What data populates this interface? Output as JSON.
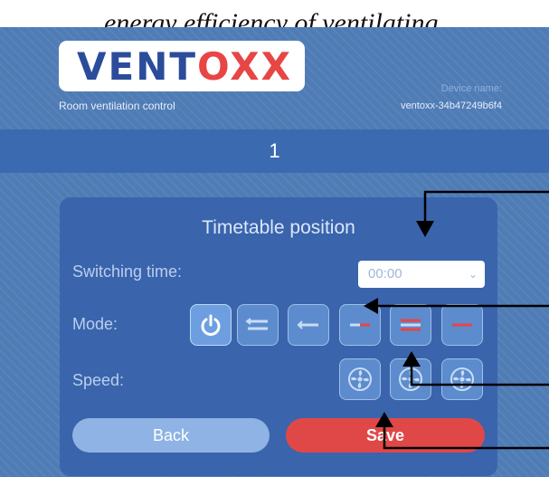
{
  "caption": "energy efficiency of ventilating,",
  "header": {
    "logo_part1": "VENT",
    "logo_part2": "O",
    "logo_part3": "XX",
    "subtitle": "Room ventilation control",
    "device_label": "Device name:",
    "device_value": "ventoxx-34b47249b6f4"
  },
  "position_bar": {
    "number": "1"
  },
  "panel": {
    "title": "Timetable position",
    "switching_label": "Switching time:",
    "switching_value": "00:00",
    "mode_label": "Mode:",
    "speed_label": "Speed:",
    "back_label": "Back",
    "save_label": "Save"
  },
  "modes": [
    {
      "icon": "power-icon",
      "active": true
    },
    {
      "icon": "two-way-flow-icon",
      "active": false
    },
    {
      "icon": "exhaust-flow-icon",
      "active": false
    },
    {
      "icon": "supply-flow-icon",
      "active": false
    },
    {
      "icon": "boost-flow-icon",
      "active": false
    },
    {
      "icon": "crossflow-icon",
      "active": false
    }
  ],
  "speeds": [
    {
      "icon": "fan-icon"
    },
    {
      "icon": "fan-icon"
    },
    {
      "icon": "fan-icon"
    }
  ],
  "colors": {
    "background": "#4f7cb5",
    "panel": "#3a64ac",
    "logo_blue": "#2b4c9b",
    "logo_red": "#e84545",
    "save_button": "#e04848",
    "back_button": "#8eb3e4"
  }
}
